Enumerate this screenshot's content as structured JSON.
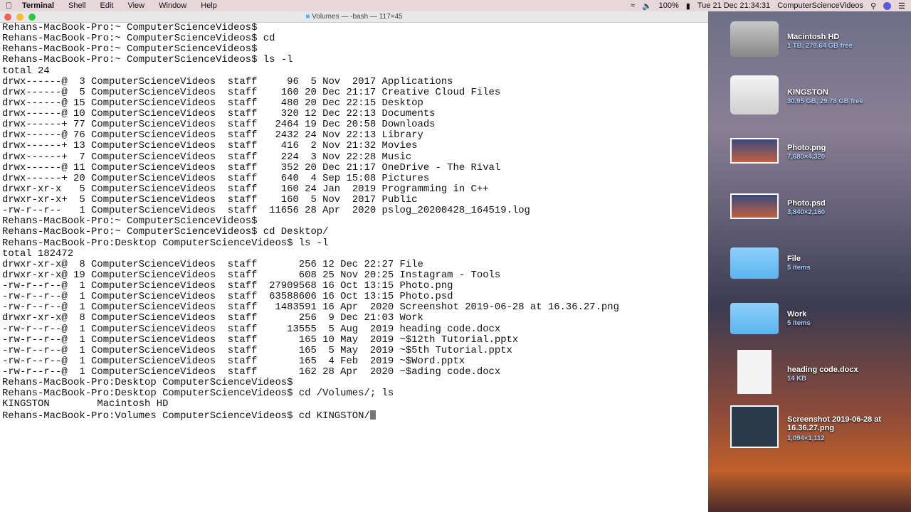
{
  "menubar": {
    "items": [
      "Terminal",
      "Shell",
      "Edit",
      "View",
      "Window",
      "Help"
    ],
    "battery": "100%",
    "datetime": "Tue 21 Dec  21:34:31",
    "user": "ComputerScienceVideos"
  },
  "window": {
    "title": "Volumes — -bash — 117×45"
  },
  "terminal": {
    "lines": [
      "Rehans-MacBook-Pro:~ ComputerScienceVideos$",
      "Rehans-MacBook-Pro:~ ComputerScienceVideos$ cd",
      "Rehans-MacBook-Pro:~ ComputerScienceVideos$",
      "Rehans-MacBook-Pro:~ ComputerScienceVideos$ ls -l",
      "total 24",
      "drwx------@  3 ComputerScienceVideos  staff     96  5 Nov  2017 Applications",
      "drwx------@  5 ComputerScienceVideos  staff    160 20 Dec 21:17 Creative Cloud Files",
      "drwx------@ 15 ComputerScienceVideos  staff    480 20 Dec 22:15 Desktop",
      "drwx------@ 10 ComputerScienceVideos  staff    320 12 Dec 22:13 Documents",
      "drwx------+ 77 ComputerScienceVideos  staff   2464 19 Dec 20:58 Downloads",
      "drwx------@ 76 ComputerScienceVideos  staff   2432 24 Nov 22:13 Library",
      "drwx------+ 13 ComputerScienceVideos  staff    416  2 Nov 21:32 Movies",
      "drwx------+  7 ComputerScienceVideos  staff    224  3 Nov 22:28 Music",
      "drwx------@ 11 ComputerScienceVideos  staff    352 20 Dec 21:17 OneDrive - The Rival",
      "drwx------+ 20 ComputerScienceVideos  staff    640  4 Sep 15:08 Pictures",
      "drwxr-xr-x   5 ComputerScienceVideos  staff    160 24 Jan  2019 Programming in C++",
      "drwxr-xr-x+  5 ComputerScienceVideos  staff    160  5 Nov  2017 Public",
      "-rw-r--r--   1 ComputerScienceVideos  staff  11656 28 Apr  2020 pslog_20200428_164519.log",
      "Rehans-MacBook-Pro:~ ComputerScienceVideos$",
      "Rehans-MacBook-Pro:~ ComputerScienceVideos$ cd Desktop/",
      "Rehans-MacBook-Pro:Desktop ComputerScienceVideos$ ls -l",
      "total 182472",
      "drwxr-xr-x@  8 ComputerScienceVideos  staff       256 12 Dec 22:27 File",
      "drwxr-xr-x@ 19 ComputerScienceVideos  staff       608 25 Nov 20:25 Instagram - Tools",
      "-rw-r--r--@  1 ComputerScienceVideos  staff  27909568 16 Oct 13:15 Photo.png",
      "-rw-r--r--@  1 ComputerScienceVideos  staff  63588606 16 Oct 13:15 Photo.psd",
      "-rw-r--r--@  1 ComputerScienceVideos  staff   1483591 16 Apr  2020 Screenshot 2019-06-28 at 16.36.27.png",
      "drwxr-xr-x@  8 ComputerScienceVideos  staff       256  9 Dec 21:03 Work",
      "-rw-r--r--@  1 ComputerScienceVideos  staff     13555  5 Aug  2019 heading code.docx",
      "-rw-r--r--@  1 ComputerScienceVideos  staff       165 10 May  2019 ~$12th Tutorial.pptx",
      "-rw-r--r--@  1 ComputerScienceVideos  staff       165  5 May  2019 ~$5th Tutorial.pptx",
      "-rw-r--r--@  1 ComputerScienceVideos  staff       165  4 Feb  2019 ~$Word.pptx",
      "-rw-r--r--@  1 ComputerScienceVideos  staff       162 28 Apr  2020 ~$ading code.docx",
      "Rehans-MacBook-Pro:Desktop ComputerScienceVideos$",
      "Rehans-MacBook-Pro:Desktop ComputerScienceVideos$ cd /Volumes/; ls",
      "KINGSTON        Macintosh HD"
    ],
    "current_line": "Rehans-MacBook-Pro:Volumes ComputerScienceVideos$ cd KINGSTON/"
  },
  "desktop": [
    {
      "name": "Macintosh HD",
      "sub": "1 TB, 278.64 GB free",
      "icon": "hard-drive-icon"
    },
    {
      "name": "KINGSTON",
      "sub": "30.95 GB, 29.78 GB free",
      "icon": "usb-drive-icon"
    },
    {
      "name": "Photo.png",
      "sub": "7,680×4,320",
      "icon": "image-icon"
    },
    {
      "name": "Photo.psd",
      "sub": "3,840×2,160",
      "icon": "image-icon"
    },
    {
      "name": "File",
      "sub": "5 items",
      "icon": "folder-icon"
    },
    {
      "name": "Work",
      "sub": "5 items",
      "icon": "folder-icon"
    },
    {
      "name": "heading code.docx",
      "sub": "14 KB",
      "icon": "docx-icon"
    },
    {
      "name": "Screenshot 2019-06-28 at 16.36.27.png",
      "sub": "1,094×1,112",
      "icon": "screenshot-icon"
    }
  ]
}
